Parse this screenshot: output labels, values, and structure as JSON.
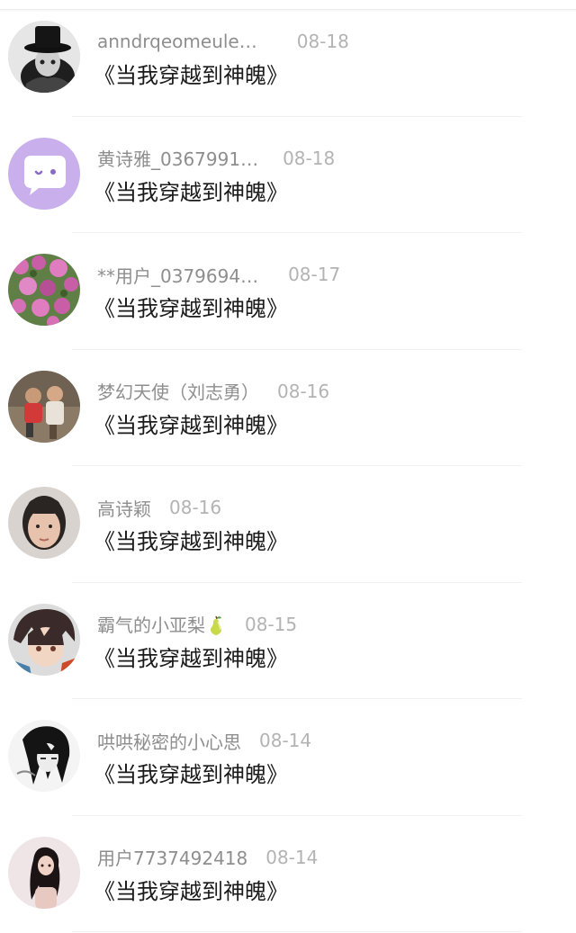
{
  "comments": [
    {
      "name": "anndrqeomeule…",
      "date": "08-18",
      "text": "《当我穿越到神魄》",
      "avatar": "top-hat-person-avatar"
    },
    {
      "name": "黄诗雅_0367991…",
      "date": "08-18",
      "text": "《当我穿越到神魄》",
      "avatar": "default-chat-bubble-avatar"
    },
    {
      "name": "**用户_0379694…",
      "date": "08-17",
      "text": "《当我穿越到神魄》",
      "avatar": "pink-flowers-avatar"
    },
    {
      "name": "梦幻天使（刘志勇）",
      "date": "08-16",
      "text": "《当我穿越到神魄》",
      "avatar": "children-photo-avatar"
    },
    {
      "name": "高诗颖",
      "date": "08-16",
      "text": "《当我穿越到神魄》",
      "avatar": "girl-face-avatar"
    },
    {
      "name": "霸气的小亚梨",
      "date": "08-15",
      "text": "《当我穿越到神魄》",
      "avatar": "anime-boy-avatar",
      "name_emoji": "pear-emoji"
    },
    {
      "name": "哄哄秘密的小心思",
      "date": "08-14",
      "text": "《当我穿越到神魄》",
      "avatar": "dark-anime-avatar"
    },
    {
      "name": "用户7737492418",
      "date": "08-14",
      "text": "《当我穿越到神魄》",
      "avatar": "woman-photo-avatar"
    }
  ],
  "colors": {
    "name_text": "#8e8e8e",
    "date_text": "#b3b3b3",
    "message_text": "#1a1a1a",
    "default_avatar_bg": "#c9b0ec"
  }
}
